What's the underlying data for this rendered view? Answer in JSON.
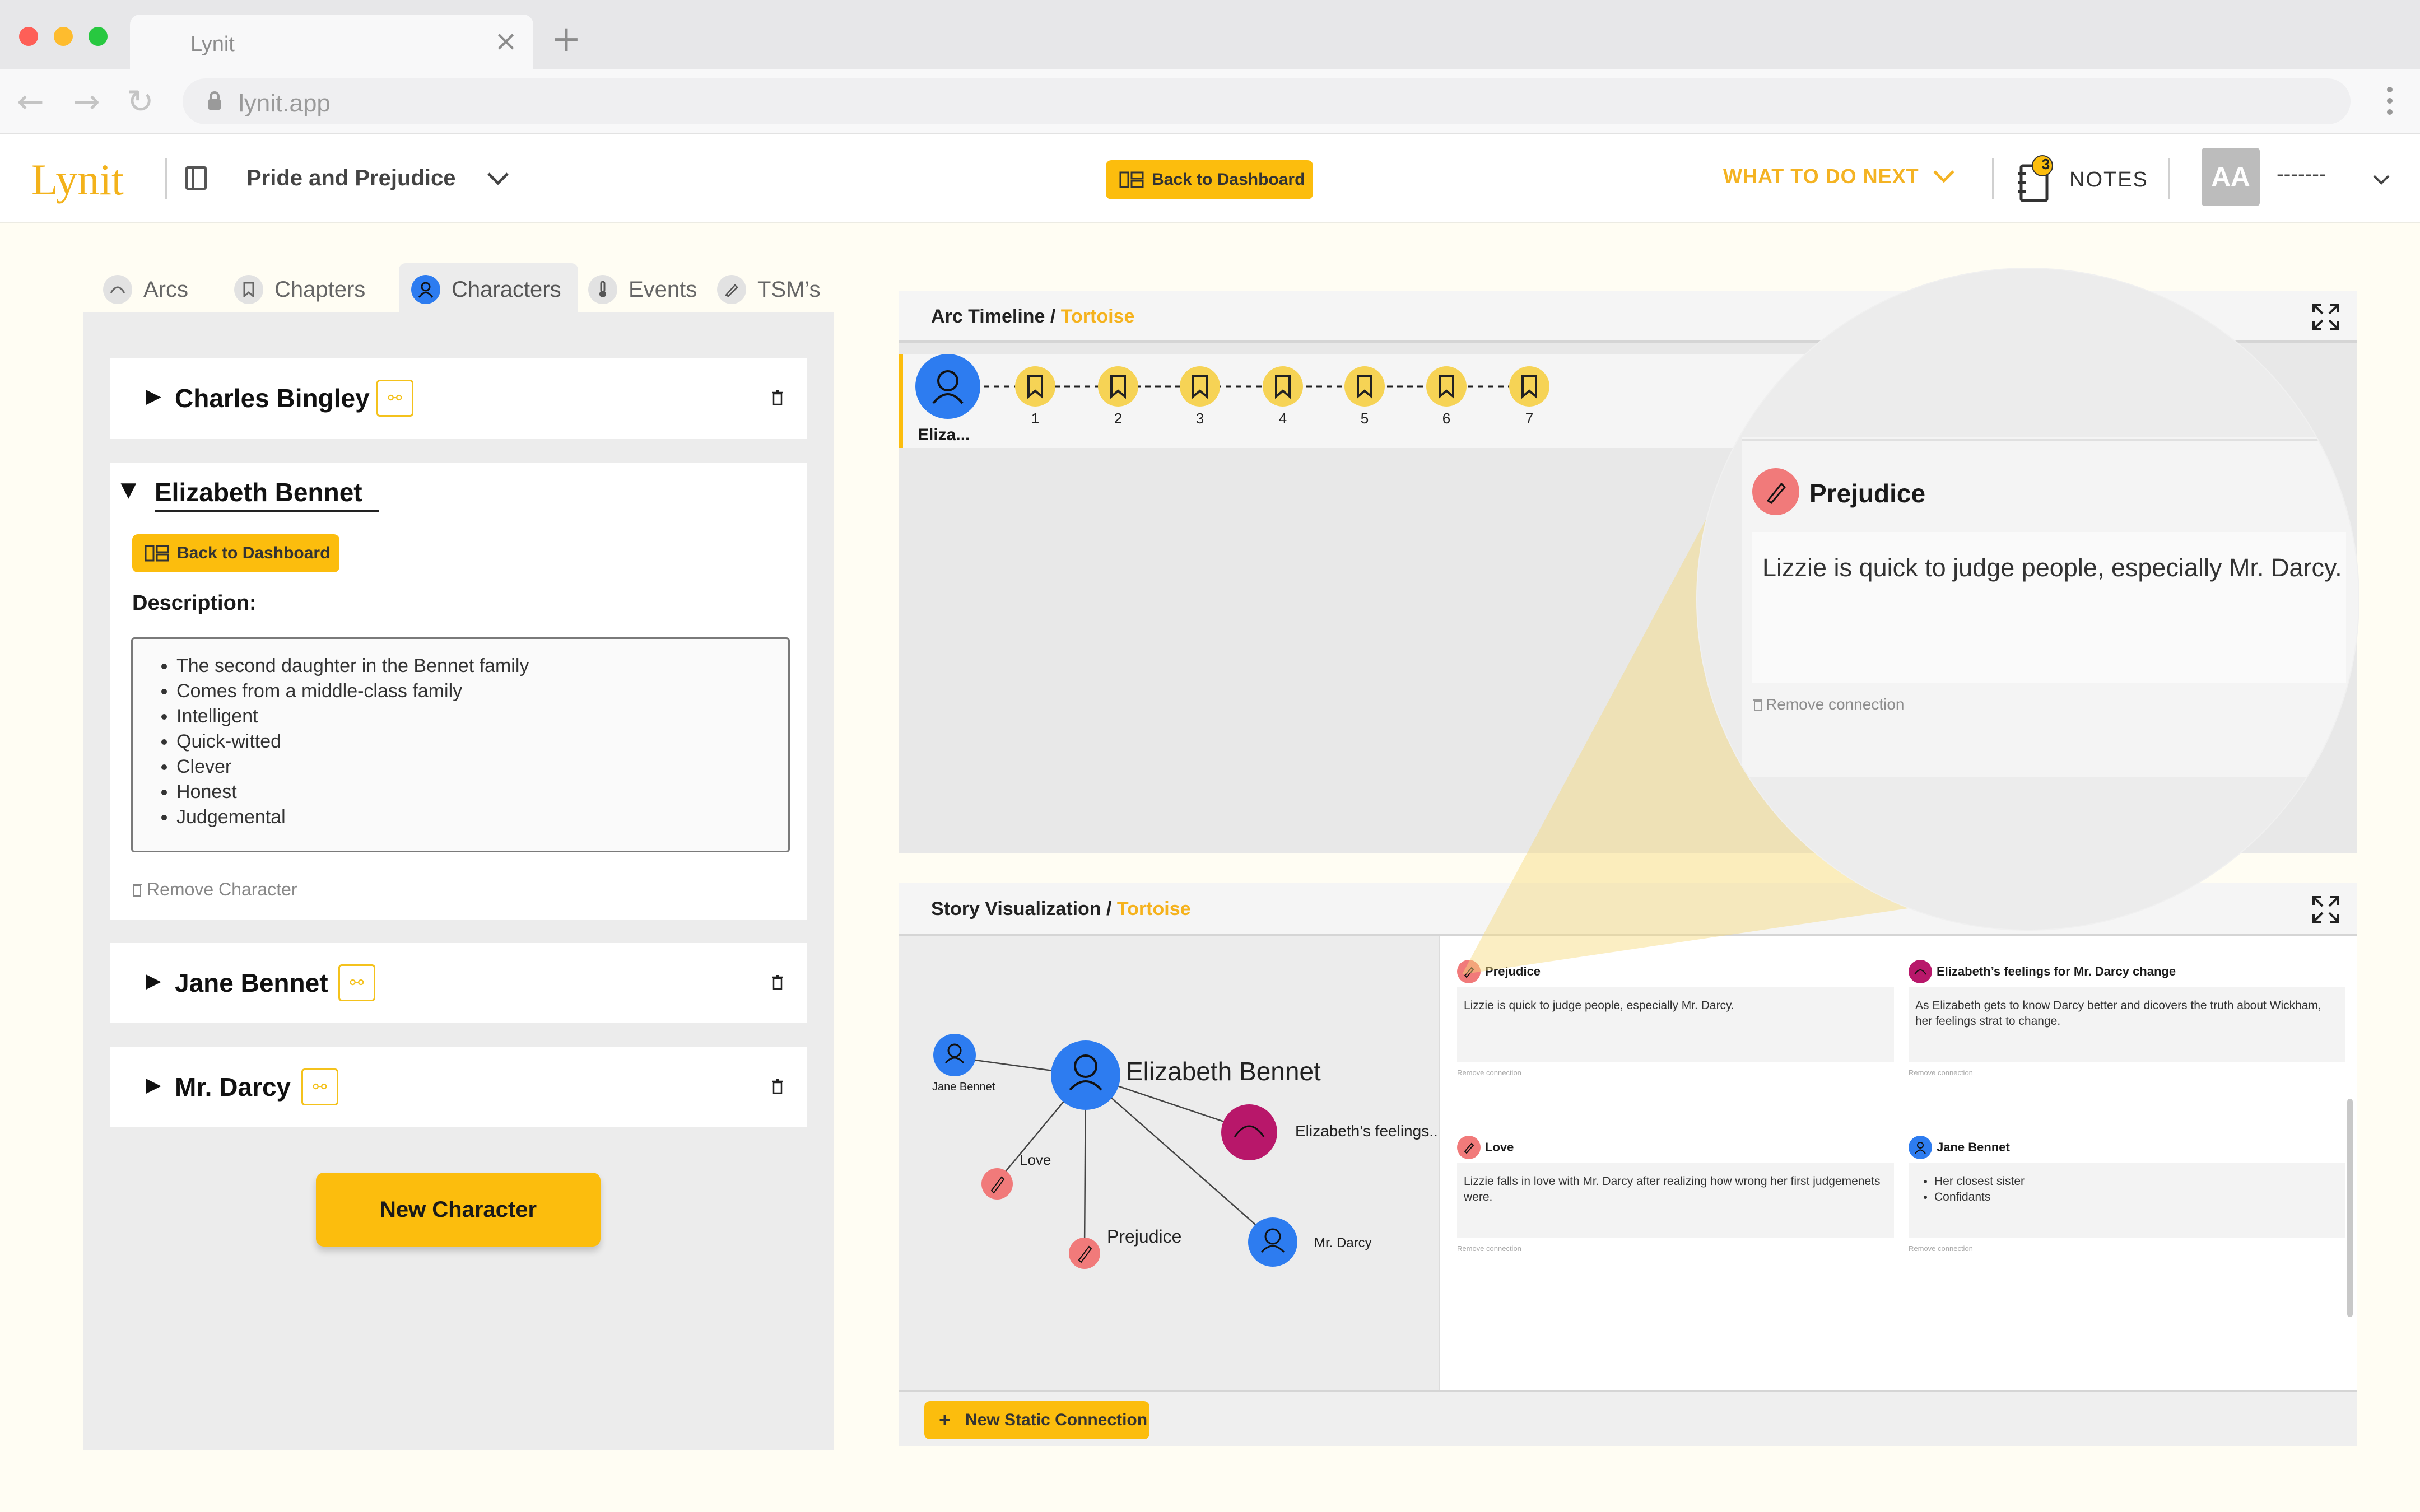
{
  "browser": {
    "tab_title": "Lynit",
    "url": "lynit.app",
    "close_glyph": "×",
    "new_tab_glyph": "+",
    "back_glyph": "←",
    "forward_glyph": "→",
    "reload_glyph": "↻"
  },
  "header": {
    "logo": "Lynit",
    "book_title": "Pride and Prejudice",
    "back_to_dashboard": "Back to Dashboard",
    "what_to_do_next": "WHAT TO DO NEXT",
    "notes_label": "NOTES",
    "notes_badge": "3",
    "avatar_initials": "AA",
    "user_name": "-------"
  },
  "side_tabs": [
    {
      "label": "Arcs",
      "icon": "arc-icon"
    },
    {
      "label": "Chapters",
      "icon": "bookmark-icon"
    },
    {
      "label": "Characters",
      "icon": "person-icon"
    },
    {
      "label": "Events",
      "icon": "thermometer-icon"
    },
    {
      "label": "TSM’s",
      "icon": "pen-icon"
    }
  ],
  "characters": {
    "collapsed": [
      {
        "name": "Charles Bingley"
      },
      {
        "name": "Jane Bennet"
      },
      {
        "name": "Mr. Darcy"
      }
    ],
    "expanded": {
      "name": "Elizabeth Bennet",
      "back_to_dashboard": "Back to Dashboard",
      "description_label": "Description:",
      "description_items": [
        "The second daughter in the Bennet family",
        "Comes from a middle-class family",
        "Intelligent",
        "Quick-witted",
        "Clever",
        "Honest",
        "Judgemental"
      ],
      "remove_label": "Remove Character"
    },
    "new_character_button": "New Character"
  },
  "arc_timeline": {
    "title": "Arc Timeline",
    "separator": " / ",
    "subtitle": "Tortoise",
    "character_label": "Eliza...",
    "chapter_numbers": [
      "1",
      "2",
      "3",
      "4",
      "5",
      "6",
      "7"
    ]
  },
  "magnifier": {
    "title": "Prejudice",
    "text": "Lizzie is quick to judge people, especially Mr. Darcy.",
    "remove_label": "Remove connection"
  },
  "story_visualization": {
    "title": "Story Visualization",
    "separator": " / ",
    "subtitle": "Tortoise",
    "graph_nodes": {
      "center": "Elizabeth Bennet",
      "jane": "Jane Bennet",
      "feelings": "Elizabeth’s feelings...",
      "love": "Love",
      "prejudice": "Prejudice",
      "darcy": "Mr. Darcy"
    },
    "cards": [
      {
        "title": "Prejudice",
        "text": "Lizzie is quick to judge people, especially Mr. Darcy.",
        "icon": "pen-icon",
        "color": "#f17a7a"
      },
      {
        "title": "Elizabeth’s feelings for Mr. Darcy change",
        "text": "As Elizabeth gets to know Darcy better and dicovers the truth about Wickham, her feelings strat to change.",
        "icon": "arc-icon",
        "color": "#b8176a"
      },
      {
        "title": "Love",
        "text": "Lizzie falls in love with Mr. Darcy after realizing how wrong her first judgemenets were.",
        "icon": "pen-icon",
        "color": "#f17a7a"
      },
      {
        "title": "Jane Bennet",
        "items": [
          "Her closest sister",
          "Confidants"
        ],
        "icon": "person-icon",
        "color": "#2d7cf0"
      }
    ],
    "card_remove_label": "Remove connection",
    "new_static_connection": "New Static Connection",
    "plus_glyph": "+"
  },
  "colors": {
    "accent_yellow": "#fcbd0d",
    "character_blue": "#2d7cf0",
    "tsm_red": "#f17a7a",
    "arc_magenta": "#b8176a"
  }
}
